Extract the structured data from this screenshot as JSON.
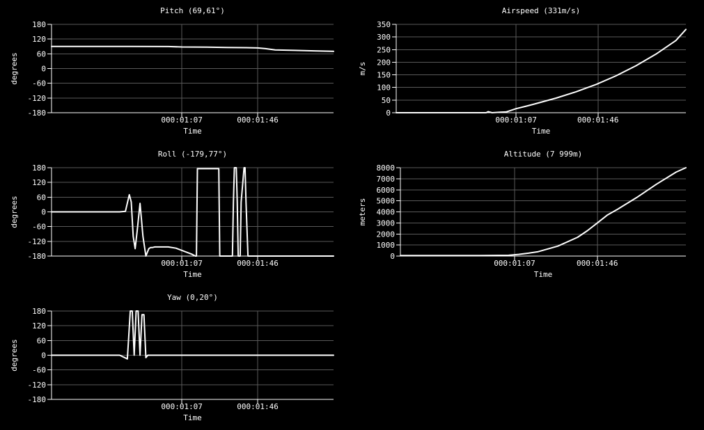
{
  "chart_data": [
    {
      "id": "pitch",
      "type": "line",
      "title": "Pitch (69,61°)",
      "xlabel": "Time",
      "ylabel": "degrees",
      "ylim": [
        -180,
        180
      ],
      "yticks": [
        -180,
        -120,
        -60,
        0,
        60,
        120,
        180
      ],
      "xlim": [
        0,
        145
      ],
      "xticks": [
        {
          "value": 67,
          "label": "000:01:07"
        },
        {
          "value": 106,
          "label": "000:01:46"
        }
      ],
      "grid": true,
      "series": [
        {
          "x": [
            0,
            20,
            40,
            60,
            67,
            80,
            90,
            100,
            106,
            110,
            115,
            125,
            135,
            145
          ],
          "y": [
            90,
            90,
            90,
            89.5,
            88,
            87,
            86,
            85,
            84,
            81,
            76,
            74,
            72,
            70
          ]
        }
      ]
    },
    {
      "id": "airspeed",
      "type": "line",
      "title": "Airspeed (331m/s)",
      "xlabel": "Time",
      "ylabel": "m/s",
      "ylim": [
        0,
        350
      ],
      "yticks": [
        0,
        50,
        100,
        150,
        200,
        250,
        300,
        350
      ],
      "xlim": [
        0,
        145
      ],
      "xticks": [
        {
          "value": 60,
          "label": "000:01:07"
        },
        {
          "value": 101,
          "label": "000:01:46"
        }
      ],
      "grid": true,
      "series": [
        {
          "x": [
            0,
            20,
            40,
            45,
            46,
            48,
            52,
            55,
            60,
            65,
            70,
            80,
            90,
            100,
            110,
            120,
            130,
            140,
            145
          ],
          "y": [
            0,
            0,
            0,
            0,
            4,
            0,
            2,
            3,
            16,
            26,
            36,
            58,
            83,
            112,
            146,
            186,
            232,
            286,
            330
          ]
        }
      ]
    },
    {
      "id": "roll",
      "type": "line",
      "title": "Roll (-179,77°)",
      "xlabel": "Time",
      "ylabel": "degrees",
      "ylim": [
        -180,
        180
      ],
      "yticks": [
        -180,
        -120,
        -60,
        0,
        60,
        120,
        180
      ],
      "xlim": [
        0,
        145
      ],
      "xticks": [
        {
          "value": 67,
          "label": "000:01:07"
        },
        {
          "value": 106,
          "label": "000:01:46"
        }
      ],
      "grid": true,
      "series": [
        {
          "x": [
            0,
            20,
            35,
            38,
            40,
            41,
            42,
            43,
            44,
            45.5,
            47,
            48.5,
            50,
            51,
            52,
            53,
            54,
            60,
            64,
            68,
            72,
            74,
            74.5,
            75,
            85,
            86,
            86.5,
            87,
            93,
            93.5,
            94,
            95,
            95.5,
            96,
            97,
            97.5,
            99,
            99.5,
            100,
            101,
            102,
            110,
            120,
            130,
            140,
            145
          ],
          "y": [
            0,
            0,
            0,
            2,
            70,
            40,
            -100,
            -150,
            -80,
            35,
            -100,
            -180,
            -150,
            -145,
            -145,
            -143,
            -143,
            -143,
            -148,
            -160,
            -172,
            -180,
            -180,
            176,
            176,
            176,
            -180,
            -180,
            -180,
            40,
            180,
            180,
            40,
            -180,
            -180,
            40,
            180,
            180,
            40,
            -180,
            -180,
            -180,
            -180,
            -180,
            -180,
            -180
          ]
        }
      ]
    },
    {
      "id": "altitude",
      "type": "line",
      "title": "Altitude (7 999m)",
      "xlabel": "Time",
      "ylabel": "meters",
      "ylim": [
        0,
        8000
      ],
      "yticks": [
        0,
        1000,
        2000,
        3000,
        4000,
        5000,
        6000,
        7000,
        8000
      ],
      "xlim": [
        0,
        145
      ],
      "xticks": [
        {
          "value": 58,
          "label": "000:01:07"
        },
        {
          "value": 100,
          "label": "000:01:46"
        }
      ],
      "grid": true,
      "series": [
        {
          "x": [
            0,
            20,
            40,
            55,
            60,
            65,
            70,
            80,
            90,
            95,
            100,
            105,
            110,
            120,
            130,
            140,
            145
          ],
          "y": [
            50,
            50,
            50,
            70,
            150,
            260,
            400,
            900,
            1700,
            2300,
            3000,
            3700,
            4200,
            5300,
            6500,
            7600,
            7999
          ]
        }
      ]
    },
    {
      "id": "yaw",
      "type": "line",
      "title": "Yaw (0,20°)",
      "xlabel": "Time",
      "ylabel": "degrees",
      "ylim": [
        -180,
        180
      ],
      "yticks": [
        -180,
        -120,
        -60,
        0,
        60,
        120,
        180
      ],
      "xlim": [
        0,
        145
      ],
      "xticks": [
        {
          "value": 67,
          "label": "000:01:07"
        },
        {
          "value": 106,
          "label": "000:01:46"
        }
      ],
      "grid": true,
      "series": [
        {
          "x": [
            0,
            20,
            35,
            39,
            40.5,
            41.5,
            42.5,
            43.5,
            44.5,
            45.5,
            46.5,
            47.5,
            48.5,
            49.5,
            50.5,
            52,
            60,
            80,
            100,
            120,
            145
          ],
          "y": [
            0,
            0,
            0,
            -15,
            180,
            180,
            0,
            180,
            180,
            0,
            165,
            165,
            -10,
            0,
            0,
            0,
            0,
            0,
            0,
            0,
            0
          ]
        }
      ]
    }
  ]
}
